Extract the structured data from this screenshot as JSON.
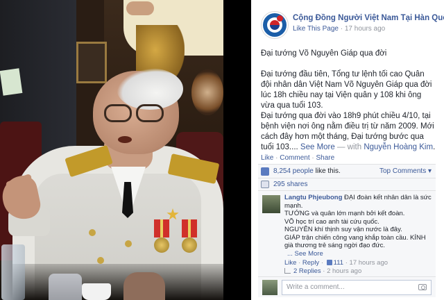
{
  "post": {
    "page_name": "Cộng Đồng Người Việt Nam Tại Hàn Quốc",
    "like_page": "Like This Page",
    "separator": " · ",
    "time": "17 hours ago",
    "title": "Đại tướng Võ Nguyên Giáp qua đời",
    "paragraphs": [
      "Đại tướng đầu tiên, Tổng tư lệnh tối cao Quân đội nhân dân Việt Nam Võ Nguyên Giáp qua đời lúc 18h chiều nay tại Viện quân y 108 khi ông vừa qua tuổi 103.",
      "Đại tướng qua đời vào 18h9 phút chiều 4/10, tại bệnh viện nơi ông nằm điều trị từ năm 2009. Mới cách đây hơn một tháng, Đại tướng bước qua tuổi 103...."
    ],
    "see_more": "See More",
    "with_dash": " — with ",
    "with_person": "Nguyễn Hoàng Kim",
    "with_end": "."
  },
  "actions": {
    "like": "Like",
    "comment": "Comment",
    "share": "Share",
    "separator": " · "
  },
  "stats": {
    "likes_count": "8,254 people",
    "likes_suffix": " like this.",
    "top_comments": "Top Comments ▾",
    "shares": "295 shares"
  },
  "comment": {
    "author": "Langtu Phjeubong",
    "lines": [
      "ĐẠI đoàn kết nhân dân là sức mạnh.",
      "TƯỚNG và quân lớn mạnh bởi kết đoàn.",
      "VÕ học trí cao anh tài cứu quốc.",
      "NGUYÊN khí thịnh suy vận nước là đây.",
      "GIÁP trận chiến công vang khắp toàn cầu. KÍNH già thương trẻ sáng ngời đạo đức."
    ],
    "see_more": "... See More",
    "like": "Like",
    "reply": "Reply",
    "like_count": "111",
    "time": "17 hours ago",
    "replies": "2 Replies",
    "replies_time": "2 hours ago"
  },
  "write_comment": {
    "placeholder": "Write a comment..."
  },
  "colors": {
    "link": "#3b5998",
    "muted": "#90949c",
    "text": "#1d2129",
    "ufi_bg": "#f6f7f9"
  }
}
